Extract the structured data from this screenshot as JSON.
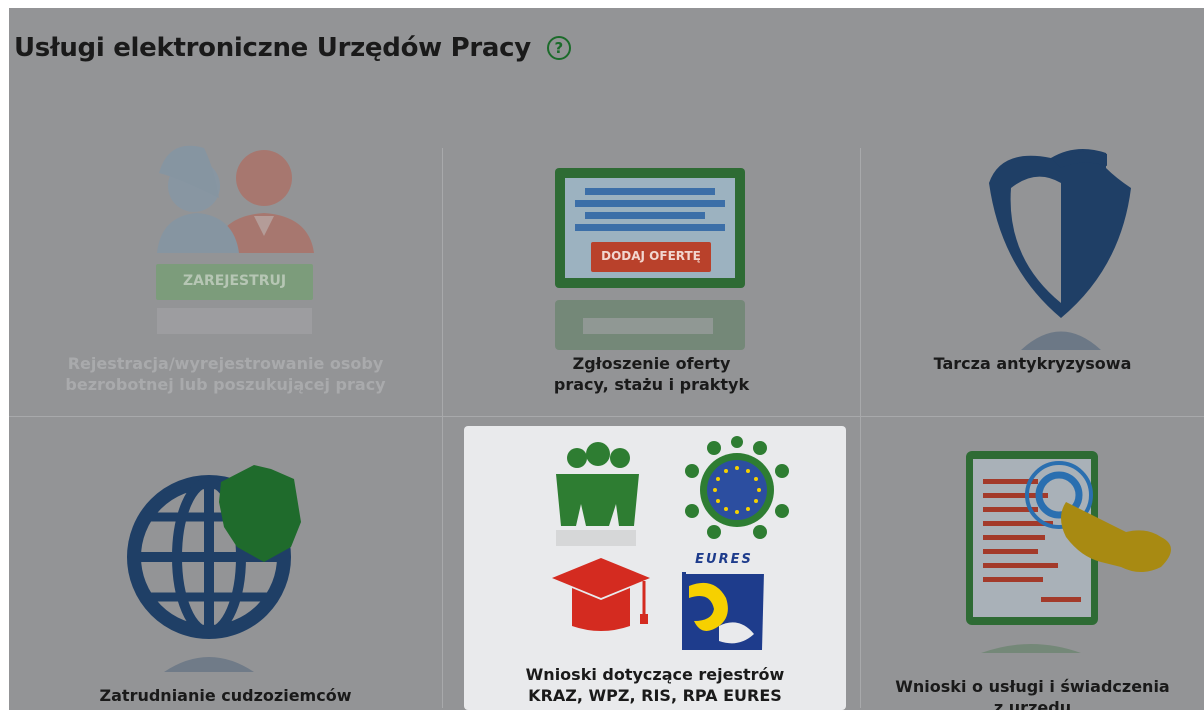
{
  "header": {
    "title": "Usługi elektroniczne Urzędów Pracy",
    "help_glyph": "?"
  },
  "tiles": [
    {
      "label_line1": "Rejestracja/wyrejestrowanie osoby",
      "label_line2": "bezrobotnej lub poszukującej pracy",
      "badge": "ZAREJESTRUJ",
      "icon": "users-icon",
      "state": "disabled"
    },
    {
      "label_line1": "Zgłoszenie oferty",
      "label_line2": "pracy, stażu i praktyk",
      "badge": "DODAJ OFERTĘ",
      "icon": "job-offer-icon"
    },
    {
      "label_line1": "Tarcza antykryzysowa",
      "icon": "shield-icon"
    },
    {
      "label_line1": "Zatrudnianie cudzoziemców",
      "icon": "globe-icon"
    },
    {
      "label_line1": "Wnioski dotyczące rejestrów",
      "label_line2": "KRAZ, WPZ, RIS, RPA EURES",
      "eures_text": "EURES",
      "icon": "registers-icon",
      "state": "hover"
    },
    {
      "label_line1": "Wnioski o usługi i świadczenia",
      "label_line2": "z urzędu",
      "icon": "document-touch-icon"
    }
  ],
  "colors": {
    "background": "#939496",
    "green": "#2e7d32",
    "navy": "#1f3f66",
    "red": "#c62828",
    "gold": "#a88a12"
  }
}
